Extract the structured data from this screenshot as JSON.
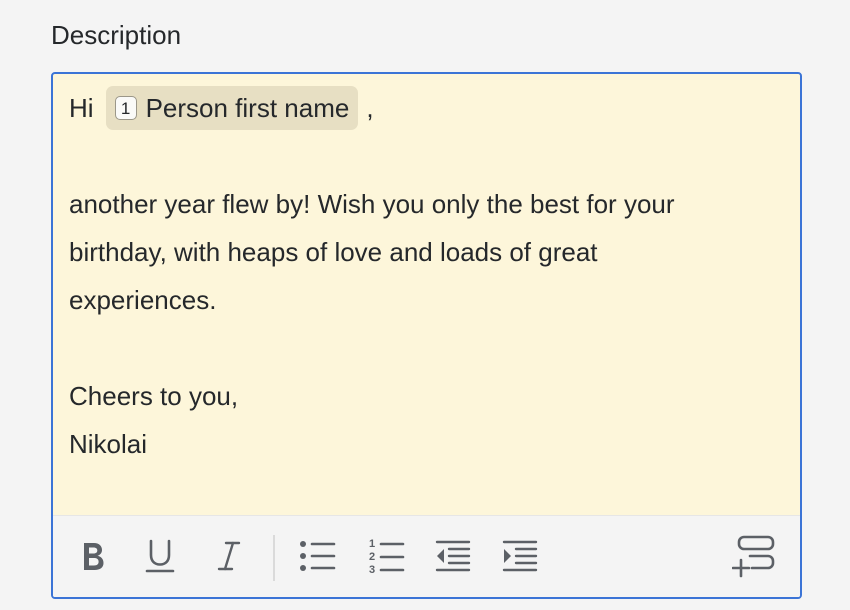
{
  "field": {
    "label": "Description"
  },
  "editor": {
    "greeting": "Hi",
    "placeholder_chip": {
      "number": "1",
      "label": "Person first name"
    },
    "greeting_suffix": ",",
    "body_lines": [
      "another year flew by! Wish you only the best for your",
      "birthday, with heaps of love and loads of great",
      "experiences."
    ],
    "closing": "Cheers to you,",
    "signature": "Nikolai",
    "background_color": "#fdf6da",
    "border_color": "#3b74d6"
  },
  "toolbar": {
    "buttons": [
      {
        "name": "bold",
        "icon": "bold-icon"
      },
      {
        "name": "underline",
        "icon": "underline-icon"
      },
      {
        "name": "italic",
        "icon": "italic-icon"
      },
      {
        "name": "bulleted-list",
        "icon": "bulleted-list-icon"
      },
      {
        "name": "numbered-list",
        "icon": "numbered-list-icon"
      },
      {
        "name": "outdent",
        "icon": "outdent-icon"
      },
      {
        "name": "indent",
        "icon": "indent-icon"
      },
      {
        "name": "insert-field",
        "icon": "insert-field-icon"
      }
    ],
    "icon_color": "#5c6066"
  }
}
